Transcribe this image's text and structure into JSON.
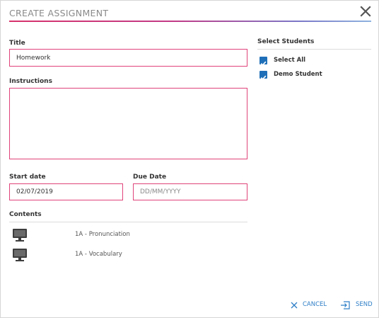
{
  "dialog": {
    "title": "CREATE ASSIGNMENT"
  },
  "form": {
    "title_label": "Title",
    "title_value": "Homework",
    "instructions_label": "Instructions",
    "instructions_value": "",
    "start_date_label": "Start date",
    "start_date_value": "02/07/2019",
    "due_date_label": "Due Date",
    "due_date_placeholder": "DD/MM/YYYY",
    "contents_label": "Contents",
    "contents": [
      {
        "icon": "monitor-icon",
        "name": "1A - Pronunciation"
      },
      {
        "icon": "monitor-icon",
        "name": "1A - Vocabulary"
      }
    ]
  },
  "students": {
    "heading": "Select Students",
    "options": [
      {
        "label": "Select All",
        "checked": true
      },
      {
        "label": "Demo Student",
        "checked": true
      }
    ]
  },
  "footer": {
    "cancel_label": "CANCEL",
    "send_label": "SEND"
  },
  "colors": {
    "accent_pink": "#e0437a",
    "accent_blue": "#2f7fc7",
    "checkbox_blue": "#1f6fb8"
  }
}
